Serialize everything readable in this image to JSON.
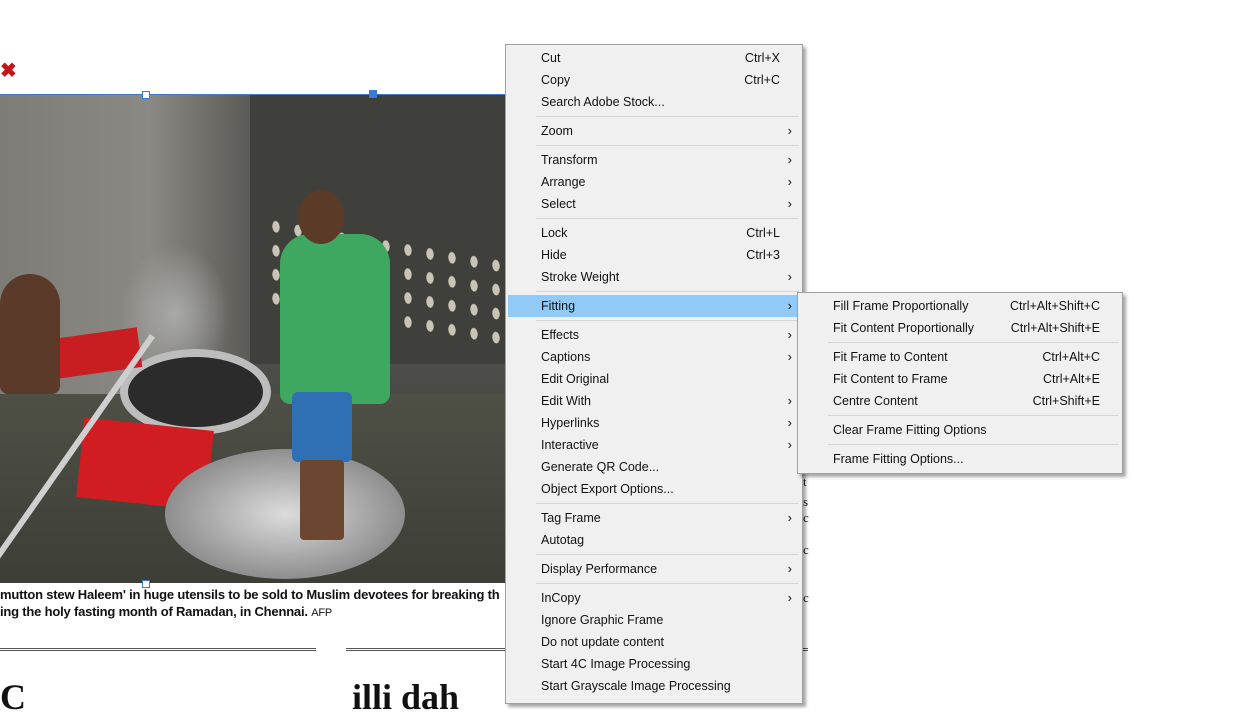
{
  "document": {
    "caption_line1": "mutton stew Haleem' in huge utensils to be sold to Muslim devotees for breaking th",
    "caption_line2": "ing the holy fasting month of Ramadan, in Chennai.",
    "caption_credit": "AFP",
    "headline_left": "C",
    "headline_right": "illi dah"
  },
  "context_menu": {
    "items": [
      {
        "label": "Cut",
        "shortcut": "Ctrl+X"
      },
      {
        "label": "Copy",
        "shortcut": "Ctrl+C"
      },
      {
        "label": "Search Adobe Stock..."
      },
      {
        "label": "Zoom",
        "submenu": true
      },
      {
        "label": "Transform",
        "submenu": true
      },
      {
        "label": "Arrange",
        "submenu": true
      },
      {
        "label": "Select",
        "submenu": true
      },
      {
        "label": "Lock",
        "shortcut": "Ctrl+L"
      },
      {
        "label": "Hide",
        "shortcut": "Ctrl+3"
      },
      {
        "label": "Stroke Weight",
        "submenu": true
      },
      {
        "label": "Fitting",
        "submenu": true,
        "highlighted": true
      },
      {
        "label": "Effects",
        "submenu": true
      },
      {
        "label": "Captions",
        "submenu": true
      },
      {
        "label": "Edit Original"
      },
      {
        "label": "Edit With",
        "submenu": true
      },
      {
        "label": "Hyperlinks",
        "submenu": true
      },
      {
        "label": "Interactive",
        "submenu": true
      },
      {
        "label": "Generate QR Code..."
      },
      {
        "label": "Object Export Options..."
      },
      {
        "label": "Tag Frame",
        "submenu": true
      },
      {
        "label": "Autotag"
      },
      {
        "label": "Display Performance",
        "submenu": true
      },
      {
        "label": "InCopy",
        "submenu": true
      },
      {
        "label": "Ignore Graphic Frame"
      },
      {
        "label": "Do not update content"
      },
      {
        "label": "Start 4C Image Processing"
      },
      {
        "label": "Start Grayscale Image Processing"
      }
    ]
  },
  "fitting_submenu": {
    "items": [
      {
        "label": "Fill Frame Proportionally",
        "shortcut": "Ctrl+Alt+Shift+C"
      },
      {
        "label": "Fit Content Proportionally",
        "shortcut": "Ctrl+Alt+Shift+E"
      },
      {
        "label": "Fit Frame to Content",
        "shortcut": "Ctrl+Alt+C"
      },
      {
        "label": "Fit Content to Frame",
        "shortcut": "Ctrl+Alt+E"
      },
      {
        "label": "Centre Content",
        "shortcut": "Ctrl+Shift+E"
      },
      {
        "label": "Clear Frame Fitting Options"
      },
      {
        "label": "Frame Fitting Options..."
      }
    ]
  },
  "colors": {
    "highlight": "#91c9f7",
    "menu_bg": "#f0f0f0",
    "selection": "#3b7bd8"
  },
  "icons": {
    "submenu_arrow": "chevron-right-icon"
  }
}
